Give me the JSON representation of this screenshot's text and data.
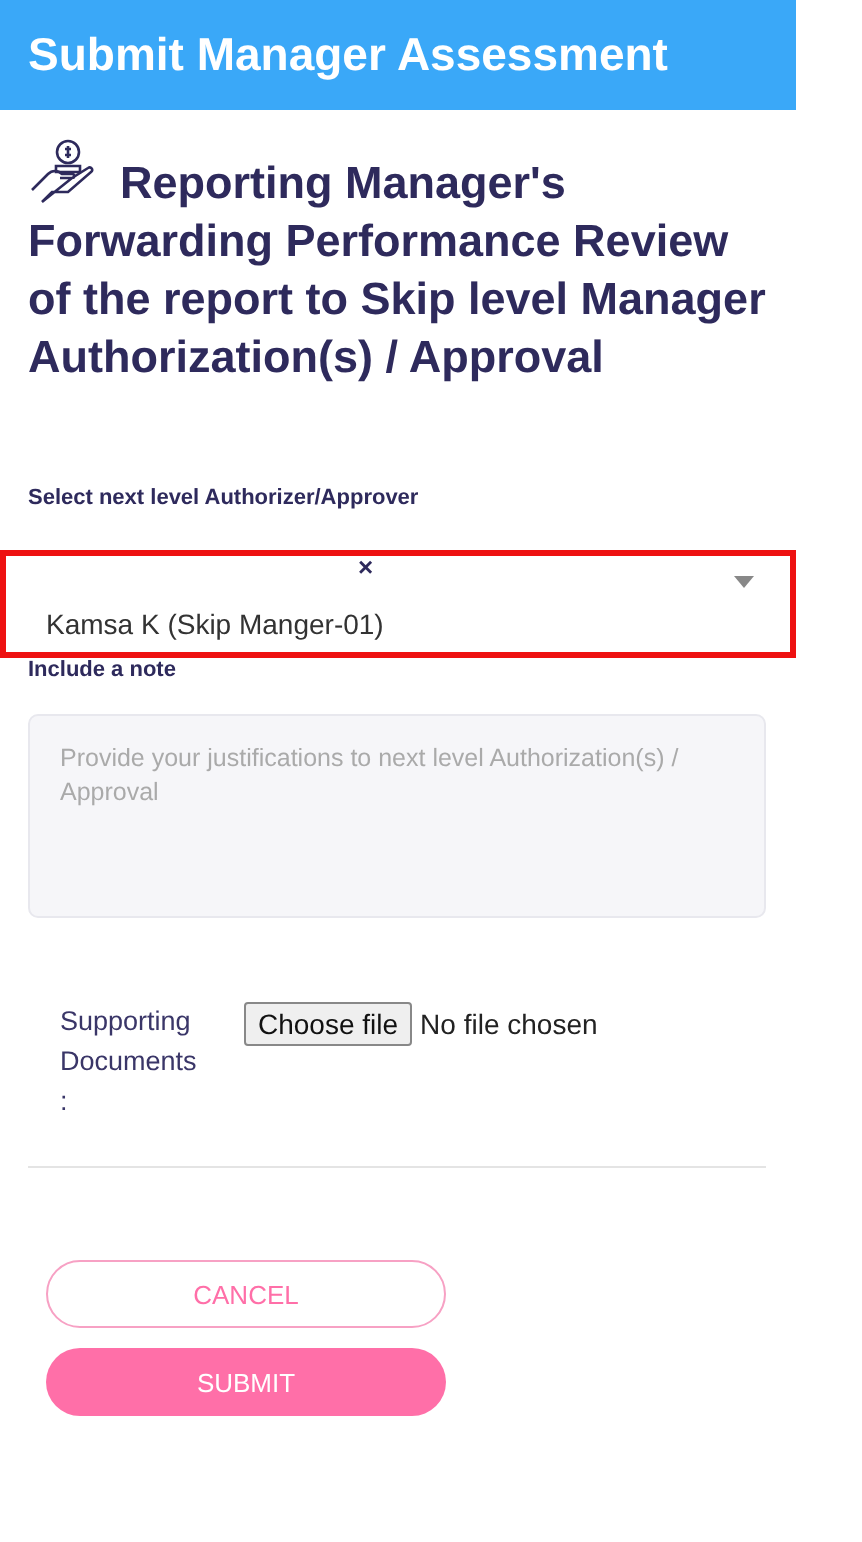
{
  "header": {
    "title": "Submit Manager Assessment"
  },
  "heading": "Reporting Manager's Forwarding Performance Review of the report to Skip level Manager Authorization(s) / Approval",
  "approver": {
    "label": "Select next level Authorizer/Approver",
    "clear": "×",
    "value": "Kamsa K (Skip Manger-01)",
    "highlighted": true
  },
  "note": {
    "label": "Include a note",
    "placeholder": "Provide your justifications to next level Authorization(s) / Approval"
  },
  "attachment": {
    "label": "Supporting Documents",
    "colon": ":",
    "button": "Choose file",
    "status": "No file chosen"
  },
  "buttons": [
    {
      "kind": "outline",
      "label": "CANCEL"
    },
    {
      "kind": "filled",
      "label": "SUBMIT"
    }
  ]
}
